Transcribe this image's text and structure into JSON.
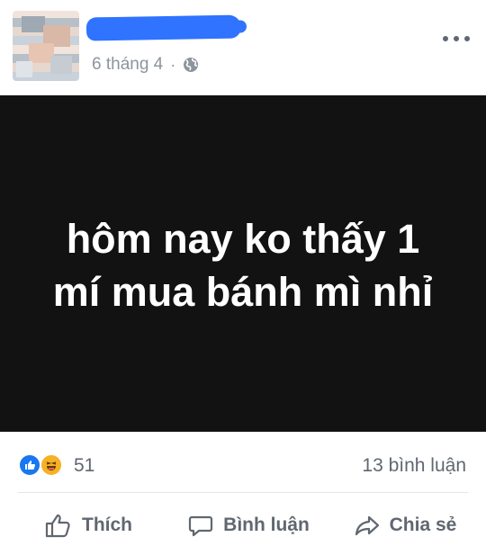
{
  "post": {
    "date": "6 tháng 4",
    "separator": "·",
    "privacy_icon": "globe-icon",
    "image_text": "hôm nay ko thấy 1 mí mua bánh mì nhỉ"
  },
  "reactions": {
    "types": [
      "like-icon",
      "haha-icon"
    ],
    "count": "51",
    "comments": "13 bình luận"
  },
  "actions": {
    "like_label": "Thích",
    "comment_label": "Bình luận",
    "share_label": "Chia sẻ"
  },
  "colors": {
    "background": "#ffffff",
    "image_background": "#121212",
    "secondary_text": "#606770",
    "redaction": "#2f73ff",
    "like": "#1877f2",
    "haha": "#f7b125"
  }
}
